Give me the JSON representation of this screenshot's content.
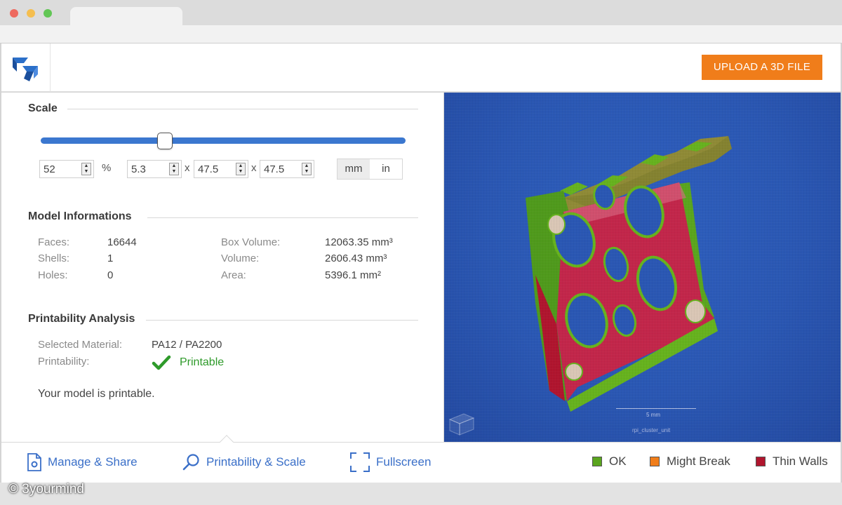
{
  "header": {
    "upload_label": "UPLOAD A 3D FILE"
  },
  "scale": {
    "title": "Scale",
    "slider_level": 0.34,
    "percent": "52",
    "percent_unit": "%",
    "x": "5.3",
    "y": "47.5",
    "z": "47.5",
    "separator": "x",
    "units": [
      "mm",
      "in"
    ],
    "active_unit": "mm"
  },
  "model_info": {
    "title": "Model Informations",
    "faces_label": "Faces:",
    "faces": "16644",
    "shells_label": "Shells:",
    "shells": "1",
    "holes_label": "Holes:",
    "holes": "0",
    "box_volume_label": "Box Volume:",
    "box_volume": "12063.35 mm³",
    "volume_label": "Volume:",
    "volume": "2606.43 mm³",
    "area_label": "Area:",
    "area": "5396.1 mm²"
  },
  "printability": {
    "title": "Printability Analysis",
    "material_label": "Selected Material:",
    "material": "PA12 / PA2200",
    "printability_label": "Printability:",
    "status": "Printable",
    "status_icon": "checkmark-icon",
    "message": "Your model is printable."
  },
  "viewer": {
    "scale_bar_label": "5 mm",
    "file_name": "rpi_cluster_unit",
    "background_color": "#2a57b3"
  },
  "footer": {
    "manage_label": "Manage & Share",
    "printability_label": "Printability & Scale",
    "fullscreen_label": "Fullscreen",
    "legend": [
      {
        "label": "OK",
        "color": "#5aa51e"
      },
      {
        "label": "Might Break",
        "color": "#f07d1a"
      },
      {
        "label": "Thin Walls",
        "color": "#b0152e"
      }
    ]
  },
  "watermark": "© 3yourmind",
  "colors": {
    "accent": "#f07d1a",
    "link": "#3a6fc8",
    "slider": "#3b77cf",
    "ok_text": "#2e9a2a"
  }
}
